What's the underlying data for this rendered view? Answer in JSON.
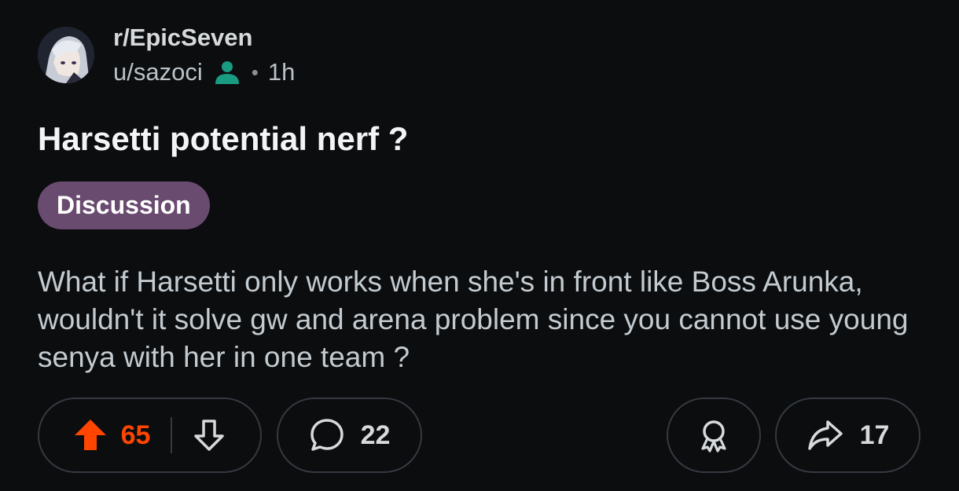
{
  "post": {
    "subreddit": "r/EpicSeven",
    "author": "u/sazoci",
    "time": "1h",
    "separator": "•",
    "title": "Harsetti potential nerf ?",
    "flair": "Discussion",
    "body": "What if Harsetti only works when she's in front like Boss Arunka, wouldn't it solve gw and arena problem since you cannot use young senya with her in one team ?"
  },
  "actions": {
    "upvotes": "65",
    "comments": "22",
    "shares": "17"
  },
  "colors": {
    "background": "#0b0d0f",
    "upvote_active": "#ff4500",
    "flair_bg": "#6a4b70",
    "user_icon": "#1a9c82"
  },
  "icons": {
    "avatar": "avatar",
    "user_badge": "user-icon",
    "upvote": "upvote-arrow-icon",
    "downvote": "downvote-arrow-icon",
    "comment": "comment-bubble-icon",
    "award": "award-icon",
    "share": "share-arrow-icon"
  }
}
